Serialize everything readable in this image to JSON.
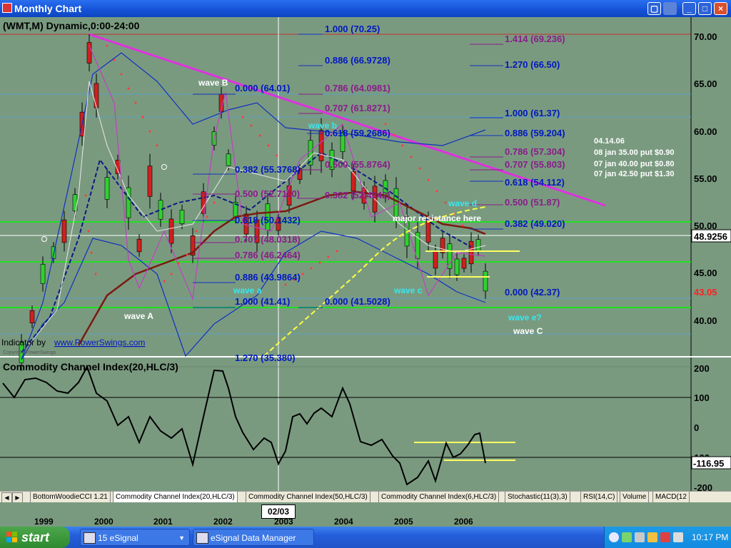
{
  "window": {
    "title": "Monthly Chart",
    "min_label": "_",
    "max_label": "□",
    "close_label": "×"
  },
  "chart": {
    "symbol_title": "(WMT,M) Dynamic,0:00-24:00",
    "price_labels": [
      "70.00",
      "65.00",
      "60.00",
      "55.00",
      "50.00",
      "45.00",
      "40.00"
    ],
    "current_price": "48.9256",
    "last_price": "43.05",
    "indicator_credit": "Indicator by",
    "indicator_link": "www.PowerSwings.com",
    "copyright": "Copyright PowerSwings",
    "fibs_blue": [
      "1.000 (70.25)",
      "0.886 (66.9728)",
      "0.000 (64.01)",
      "0.618 (59.2686)",
      "0.382 (55.3768)",
      "0.618 (50.1432)",
      "0.886 (43.9864)",
      "1.000 (41.41)",
      "0.000 (41.5028)",
      "1.270 (66.50)",
      "1.000 (61.37)",
      "0.886 (59.204)",
      "0.618 (54.112)",
      "0.382 (49.020)",
      "0.000 (42.37)",
      "1.270 (35.380)"
    ],
    "fibs_purple": [
      "1.414 (69.236)",
      "0.786 (64.0981)",
      "0.707 (61.8271)",
      "0.500 (55.8764)",
      "0.382 (52.4842)",
      "0.500 (52.7110)",
      "0.707 (48.0318)",
      "0.786 (46.2464)",
      "0.786 (57.304)",
      "0.707 (55.803)",
      "0.500 (51.87)"
    ],
    "waves": {
      "wave_B": "wave B",
      "wave_b": "wave b",
      "wave_A": "wave A",
      "wave_a": "wave a",
      "wave_c": "wave c",
      "wave_d": "wave d",
      "wave_e": "wave e?",
      "wave_C": "wave C",
      "major": "major resistance here"
    },
    "notes": [
      "04.14.06",
      "08 jan 35.00 put $0.90",
      "07 jan 40.00 put $0.80",
      "07 jan 42.50 put $1.30"
    ]
  },
  "cci": {
    "title": "Commodity Channel Index(20,HLC/3)",
    "labels": [
      "200",
      "100",
      "0",
      "-100",
      "-200"
    ],
    "current": "-116.95"
  },
  "tabs": [
    "BottomWoodieCCI 1.21",
    "Commodity Channel Index(20,HLC/3)",
    "Commodity Channel Index(50,HLC/3)",
    "Commodity Channel Index(6,HLC/3)",
    "Stochastic(11(3),3)",
    "RSI(14,C)",
    "Volume",
    "MACD(12"
  ],
  "xaxis": {
    "years": [
      "1999",
      "2000",
      "2001",
      "2002",
      "2003",
      "2004",
      "2005",
      "2006"
    ],
    "cursor_date": "02/03"
  },
  "taskbar": {
    "start": "start",
    "btn1": "15 eSignal",
    "btn2": "eSignal Data Manager",
    "clock": "10:17 PM"
  },
  "colors": {
    "background": "#7a9a80",
    "resistance_line": "#e030e0",
    "fib_blue": "#0018c0",
    "fib_purple": "#8a1c8a",
    "wave_cyan": "#38e8f0",
    "yellow": "#ffff40"
  }
}
